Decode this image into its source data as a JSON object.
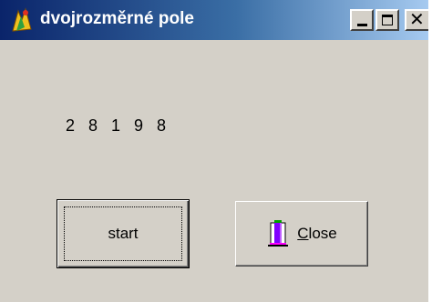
{
  "window": {
    "title": "dvojrozměrné pole",
    "icon": "app-logo-icon",
    "controls": {
      "minimize_icon": "minimize-icon",
      "maximize_icon": "maximize-icon",
      "close_glyph": "✕"
    }
  },
  "output": {
    "values": "2 8 1 9 8"
  },
  "buttons": {
    "start_label": "start",
    "close_label_accel": "C",
    "close_label_rest": "lose",
    "close_icon": "door-exit-icon"
  },
  "colors": {
    "face": "#d4d0c8",
    "title_start": "#0a246a",
    "title_end": "#a6caf0"
  }
}
